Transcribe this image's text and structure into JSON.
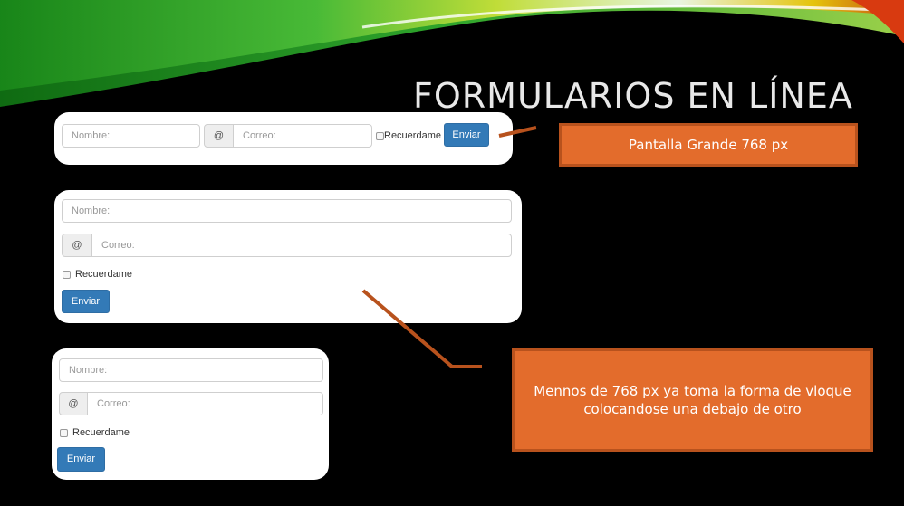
{
  "slide": {
    "title": "FORMULARIOS EN LÍNEA"
  },
  "form_large": {
    "name_placeholder": "Nombre:",
    "email_addon": "@",
    "email_placeholder": "Correo:",
    "remember_label": "Recuerdame",
    "submit_label": "Enviar"
  },
  "form_medium": {
    "name_placeholder": "Nombre:",
    "email_addon": "@",
    "email_placeholder": "Correo:",
    "remember_label": "Recuerdame",
    "submit_label": "Enviar"
  },
  "form_small": {
    "name_placeholder": "Nombre:",
    "email_addon": "@",
    "email_placeholder": "Correo:",
    "remember_label": "Recuerdame",
    "submit_label": "Enviar"
  },
  "callouts": {
    "large_screen": "Pantalla Grande 768 px",
    "small_screen": "Mennos de 768 px ya toma la forma de vloque colocandose una debajo de otro"
  },
  "colors": {
    "background": "#000000",
    "callout": "#e36c2c",
    "connector": "#b8521d",
    "button": "#337ab7"
  }
}
